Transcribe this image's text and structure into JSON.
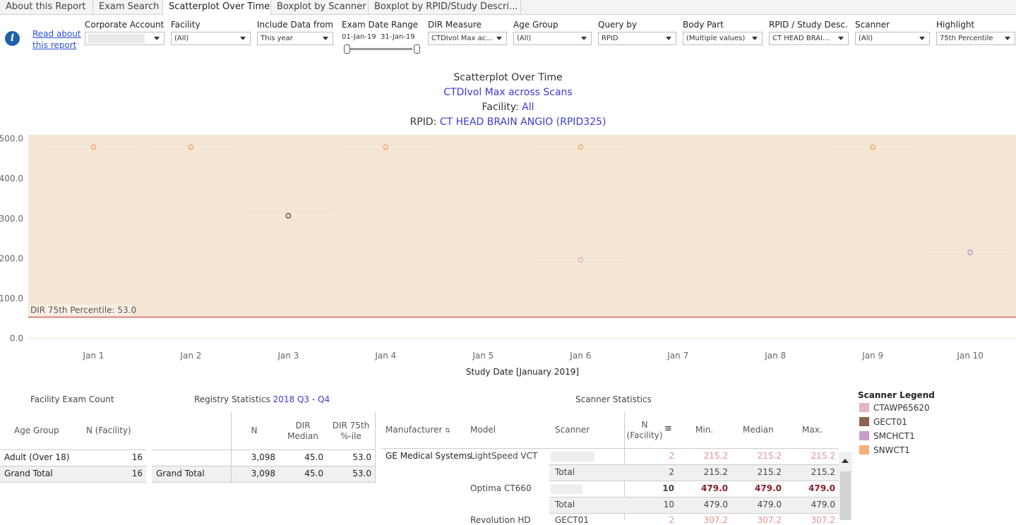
{
  "tabs": [
    {
      "label": "About this Report",
      "active": false
    },
    {
      "label": "Exam Search",
      "active": false
    },
    {
      "label": "Scatterplot Over Time",
      "active": true
    },
    {
      "label": "Boxplot by Scanner",
      "active": false
    },
    {
      "label": "Boxplot by RPID/Study Descri...",
      "active": false
    }
  ],
  "read_about": "Read about this report",
  "filters": {
    "corporate_account": {
      "label": "Corporate Account",
      "value": ""
    },
    "facility": {
      "label": "Facility",
      "value": "(All)"
    },
    "include_data_from": {
      "label": "Include Data from",
      "value": "This year"
    },
    "exam_date_range": {
      "label": "Exam Date Range",
      "start": "01-Jan-19",
      "end": "31-Jan-19"
    },
    "dir_measure": {
      "label": "DIR Measure",
      "value": "CTDIvol Max ac..."
    },
    "age_group": {
      "label": "Age Group",
      "value": "(All)"
    },
    "query_by": {
      "label": "Query by",
      "value": "RPID"
    },
    "body_part": {
      "label": "Body Part",
      "value": "(Multiple values)"
    },
    "rpid_study": {
      "label": "RPID / Study Desc...",
      "value": "CT HEAD BRAI..."
    },
    "scanner": {
      "label": "Scanner",
      "value": "(All)"
    },
    "highlight": {
      "label": "Highlight",
      "value": "75th Percentile"
    }
  },
  "titles": {
    "main": "Scatterplot Over Time",
    "measure": "CTDIvol Max across Scans",
    "facility_label": "Facility: ",
    "facility_value": "All",
    "rpid_label": "RPID: ",
    "rpid_value": "CT HEAD BRAIN ANGIO (RPID325)"
  },
  "colors": {
    "band": "#f3e6d4",
    "reference": "#e06060",
    "CTAWP65620": "#e8b4c8",
    "GECT01": "#8b6351",
    "SMCHCT1": "#c79fc6",
    "SNWCT1": "#f5b07a",
    "link": "#3a3ad6",
    "value_red": "#8b1a2b",
    "value_pink": "#e89090"
  },
  "chart_data": {
    "type": "scatter",
    "xlabel": "Study Date [January 2019]",
    "x_ticks": [
      "Jan 1",
      "Jan 2",
      "Jan 3",
      "Jan 4",
      "Jan 5",
      "Jan 6",
      "Jan 7",
      "Jan 8",
      "Jan 9",
      "Jan 10"
    ],
    "y_ticks": [
      0,
      100,
      200,
      300,
      400,
      500
    ],
    "y_tick_labels": [
      "0.0",
      "100.0",
      "200.0",
      "300.0",
      "400.0",
      "500.0"
    ],
    "ylim": [
      -15,
      510
    ],
    "xlim": [
      0.33,
      10.47
    ],
    "grid": true,
    "reference_line": {
      "label": "DIR 75th Percentile: 53.0",
      "value": 53.0
    },
    "series": [
      {
        "name": "SNWCT1",
        "points": [
          [
            1,
            479
          ],
          [
            2,
            479
          ],
          [
            4,
            479
          ],
          [
            6,
            479
          ],
          [
            9,
            479
          ]
        ]
      },
      {
        "name": "GECT01",
        "points": [
          [
            3,
            307.2
          ]
        ]
      },
      {
        "name": "CTAWP65620",
        "points": [
          [
            6,
            197
          ]
        ]
      },
      {
        "name": "SMCHCT1",
        "points": [
          [
            10,
            215.2
          ]
        ]
      }
    ]
  },
  "facility_exam_count": {
    "title": "Facility Exam Count",
    "headers": [
      "Age Group",
      "N (Facility)"
    ],
    "rows": [
      [
        "Adult (Over 18)",
        "16"
      ]
    ],
    "total": [
      "Grand Total",
      "16"
    ]
  },
  "registry_statistics": {
    "title": "Registry Statistics ",
    "period": "2018 Q3 - Q4",
    "headers": [
      "N",
      "DIR Median",
      "DIR 75th %-ile"
    ],
    "rows": [
      [
        "3,098",
        "45.0",
        "53.0"
      ]
    ],
    "total_label": "Grand Total",
    "total": [
      "3,098",
      "45.0",
      "53.0"
    ]
  },
  "scanner_statistics": {
    "title": "Scanner Statistics",
    "headers": [
      "Manufacturer",
      "Model",
      "Scanner",
      "N (Facility)",
      "Min.",
      "Median",
      "Max."
    ],
    "manufacturer": "GE Medical Systems",
    "rows": [
      {
        "model": "LightSpeed VCT",
        "scanner": "",
        "n": "2",
        "min": "215.2",
        "median": "215.2",
        "max": "215.2",
        "style": "pink"
      },
      {
        "model": "",
        "scanner": "Total",
        "n": "2",
        "min": "215.2",
        "median": "215.2",
        "max": "215.2",
        "style": "total"
      },
      {
        "model": "Optima CT660",
        "scanner": "",
        "n": "10",
        "min": "479.0",
        "median": "479.0",
        "max": "479.0",
        "style": "red"
      },
      {
        "model": "",
        "scanner": "Total",
        "n": "10",
        "min": "479.0",
        "median": "479.0",
        "max": "479.0",
        "style": "total"
      },
      {
        "model": "Revolution HD",
        "scanner": "GECT01",
        "n": "2",
        "min": "307.2",
        "median": "307.2",
        "max": "307.2",
        "style": "pink"
      }
    ]
  },
  "scanner_legend": {
    "title": "Scanner Legend",
    "items": [
      "CTAWP65620",
      "GECT01",
      "SMCHCT1",
      "SNWCT1"
    ]
  }
}
